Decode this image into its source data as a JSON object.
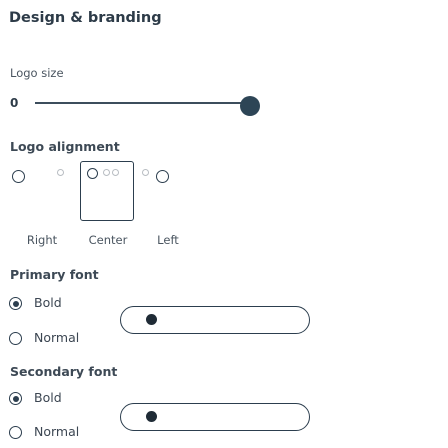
{
  "section_title": "Design & branding",
  "logo_size": {
    "label": "Logo size",
    "value": "0"
  },
  "logo_alignment": {
    "label": "Logo alignment",
    "options": [
      "Right",
      "Center",
      "Left"
    ]
  },
  "primary_font": {
    "label": "Primary font",
    "options": [
      "Bold",
      "Normal"
    ],
    "selected": "Bold"
  },
  "secondary_font": {
    "label": "Secondary font",
    "options": [
      "Bold",
      "Normal"
    ],
    "selected": "Bold"
  }
}
